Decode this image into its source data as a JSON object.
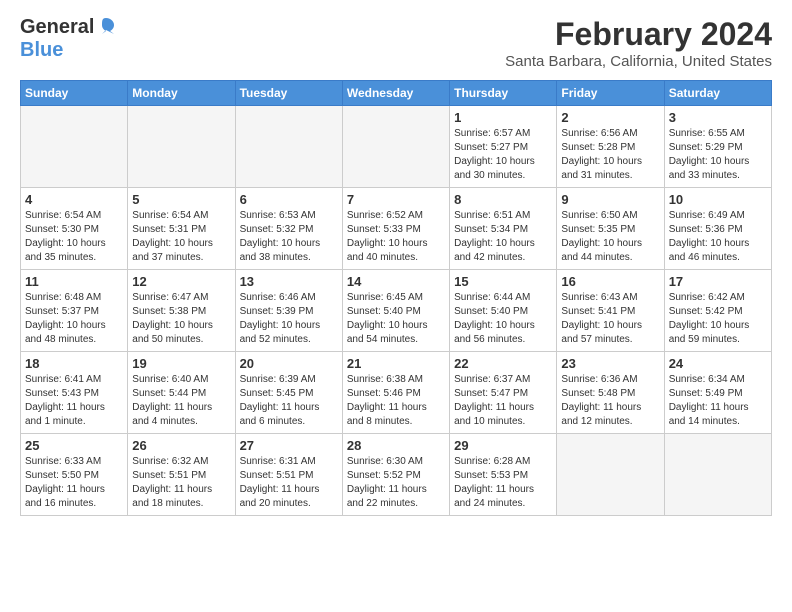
{
  "logo": {
    "text1": "General",
    "text2": "Blue"
  },
  "header": {
    "month": "February 2024",
    "location": "Santa Barbara, California, United States"
  },
  "weekdays": [
    "Sunday",
    "Monday",
    "Tuesday",
    "Wednesday",
    "Thursday",
    "Friday",
    "Saturday"
  ],
  "weeks": [
    [
      {
        "day": "",
        "info": ""
      },
      {
        "day": "",
        "info": ""
      },
      {
        "day": "",
        "info": ""
      },
      {
        "day": "",
        "info": ""
      },
      {
        "day": "1",
        "info": "Sunrise: 6:57 AM\nSunset: 5:27 PM\nDaylight: 10 hours\nand 30 minutes."
      },
      {
        "day": "2",
        "info": "Sunrise: 6:56 AM\nSunset: 5:28 PM\nDaylight: 10 hours\nand 31 minutes."
      },
      {
        "day": "3",
        "info": "Sunrise: 6:55 AM\nSunset: 5:29 PM\nDaylight: 10 hours\nand 33 minutes."
      }
    ],
    [
      {
        "day": "4",
        "info": "Sunrise: 6:54 AM\nSunset: 5:30 PM\nDaylight: 10 hours\nand 35 minutes."
      },
      {
        "day": "5",
        "info": "Sunrise: 6:54 AM\nSunset: 5:31 PM\nDaylight: 10 hours\nand 37 minutes."
      },
      {
        "day": "6",
        "info": "Sunrise: 6:53 AM\nSunset: 5:32 PM\nDaylight: 10 hours\nand 38 minutes."
      },
      {
        "day": "7",
        "info": "Sunrise: 6:52 AM\nSunset: 5:33 PM\nDaylight: 10 hours\nand 40 minutes."
      },
      {
        "day": "8",
        "info": "Sunrise: 6:51 AM\nSunset: 5:34 PM\nDaylight: 10 hours\nand 42 minutes."
      },
      {
        "day": "9",
        "info": "Sunrise: 6:50 AM\nSunset: 5:35 PM\nDaylight: 10 hours\nand 44 minutes."
      },
      {
        "day": "10",
        "info": "Sunrise: 6:49 AM\nSunset: 5:36 PM\nDaylight: 10 hours\nand 46 minutes."
      }
    ],
    [
      {
        "day": "11",
        "info": "Sunrise: 6:48 AM\nSunset: 5:37 PM\nDaylight: 10 hours\nand 48 minutes."
      },
      {
        "day": "12",
        "info": "Sunrise: 6:47 AM\nSunset: 5:38 PM\nDaylight: 10 hours\nand 50 minutes."
      },
      {
        "day": "13",
        "info": "Sunrise: 6:46 AM\nSunset: 5:39 PM\nDaylight: 10 hours\nand 52 minutes."
      },
      {
        "day": "14",
        "info": "Sunrise: 6:45 AM\nSunset: 5:40 PM\nDaylight: 10 hours\nand 54 minutes."
      },
      {
        "day": "15",
        "info": "Sunrise: 6:44 AM\nSunset: 5:40 PM\nDaylight: 10 hours\nand 56 minutes."
      },
      {
        "day": "16",
        "info": "Sunrise: 6:43 AM\nSunset: 5:41 PM\nDaylight: 10 hours\nand 57 minutes."
      },
      {
        "day": "17",
        "info": "Sunrise: 6:42 AM\nSunset: 5:42 PM\nDaylight: 10 hours\nand 59 minutes."
      }
    ],
    [
      {
        "day": "18",
        "info": "Sunrise: 6:41 AM\nSunset: 5:43 PM\nDaylight: 11 hours\nand 1 minute."
      },
      {
        "day": "19",
        "info": "Sunrise: 6:40 AM\nSunset: 5:44 PM\nDaylight: 11 hours\nand 4 minutes."
      },
      {
        "day": "20",
        "info": "Sunrise: 6:39 AM\nSunset: 5:45 PM\nDaylight: 11 hours\nand 6 minutes."
      },
      {
        "day": "21",
        "info": "Sunrise: 6:38 AM\nSunset: 5:46 PM\nDaylight: 11 hours\nand 8 minutes."
      },
      {
        "day": "22",
        "info": "Sunrise: 6:37 AM\nSunset: 5:47 PM\nDaylight: 11 hours\nand 10 minutes."
      },
      {
        "day": "23",
        "info": "Sunrise: 6:36 AM\nSunset: 5:48 PM\nDaylight: 11 hours\nand 12 minutes."
      },
      {
        "day": "24",
        "info": "Sunrise: 6:34 AM\nSunset: 5:49 PM\nDaylight: 11 hours\nand 14 minutes."
      }
    ],
    [
      {
        "day": "25",
        "info": "Sunrise: 6:33 AM\nSunset: 5:50 PM\nDaylight: 11 hours\nand 16 minutes."
      },
      {
        "day": "26",
        "info": "Sunrise: 6:32 AM\nSunset: 5:51 PM\nDaylight: 11 hours\nand 18 minutes."
      },
      {
        "day": "27",
        "info": "Sunrise: 6:31 AM\nSunset: 5:51 PM\nDaylight: 11 hours\nand 20 minutes."
      },
      {
        "day": "28",
        "info": "Sunrise: 6:30 AM\nSunset: 5:52 PM\nDaylight: 11 hours\nand 22 minutes."
      },
      {
        "day": "29",
        "info": "Sunrise: 6:28 AM\nSunset: 5:53 PM\nDaylight: 11 hours\nand 24 minutes."
      },
      {
        "day": "",
        "info": ""
      },
      {
        "day": "",
        "info": ""
      }
    ]
  ]
}
